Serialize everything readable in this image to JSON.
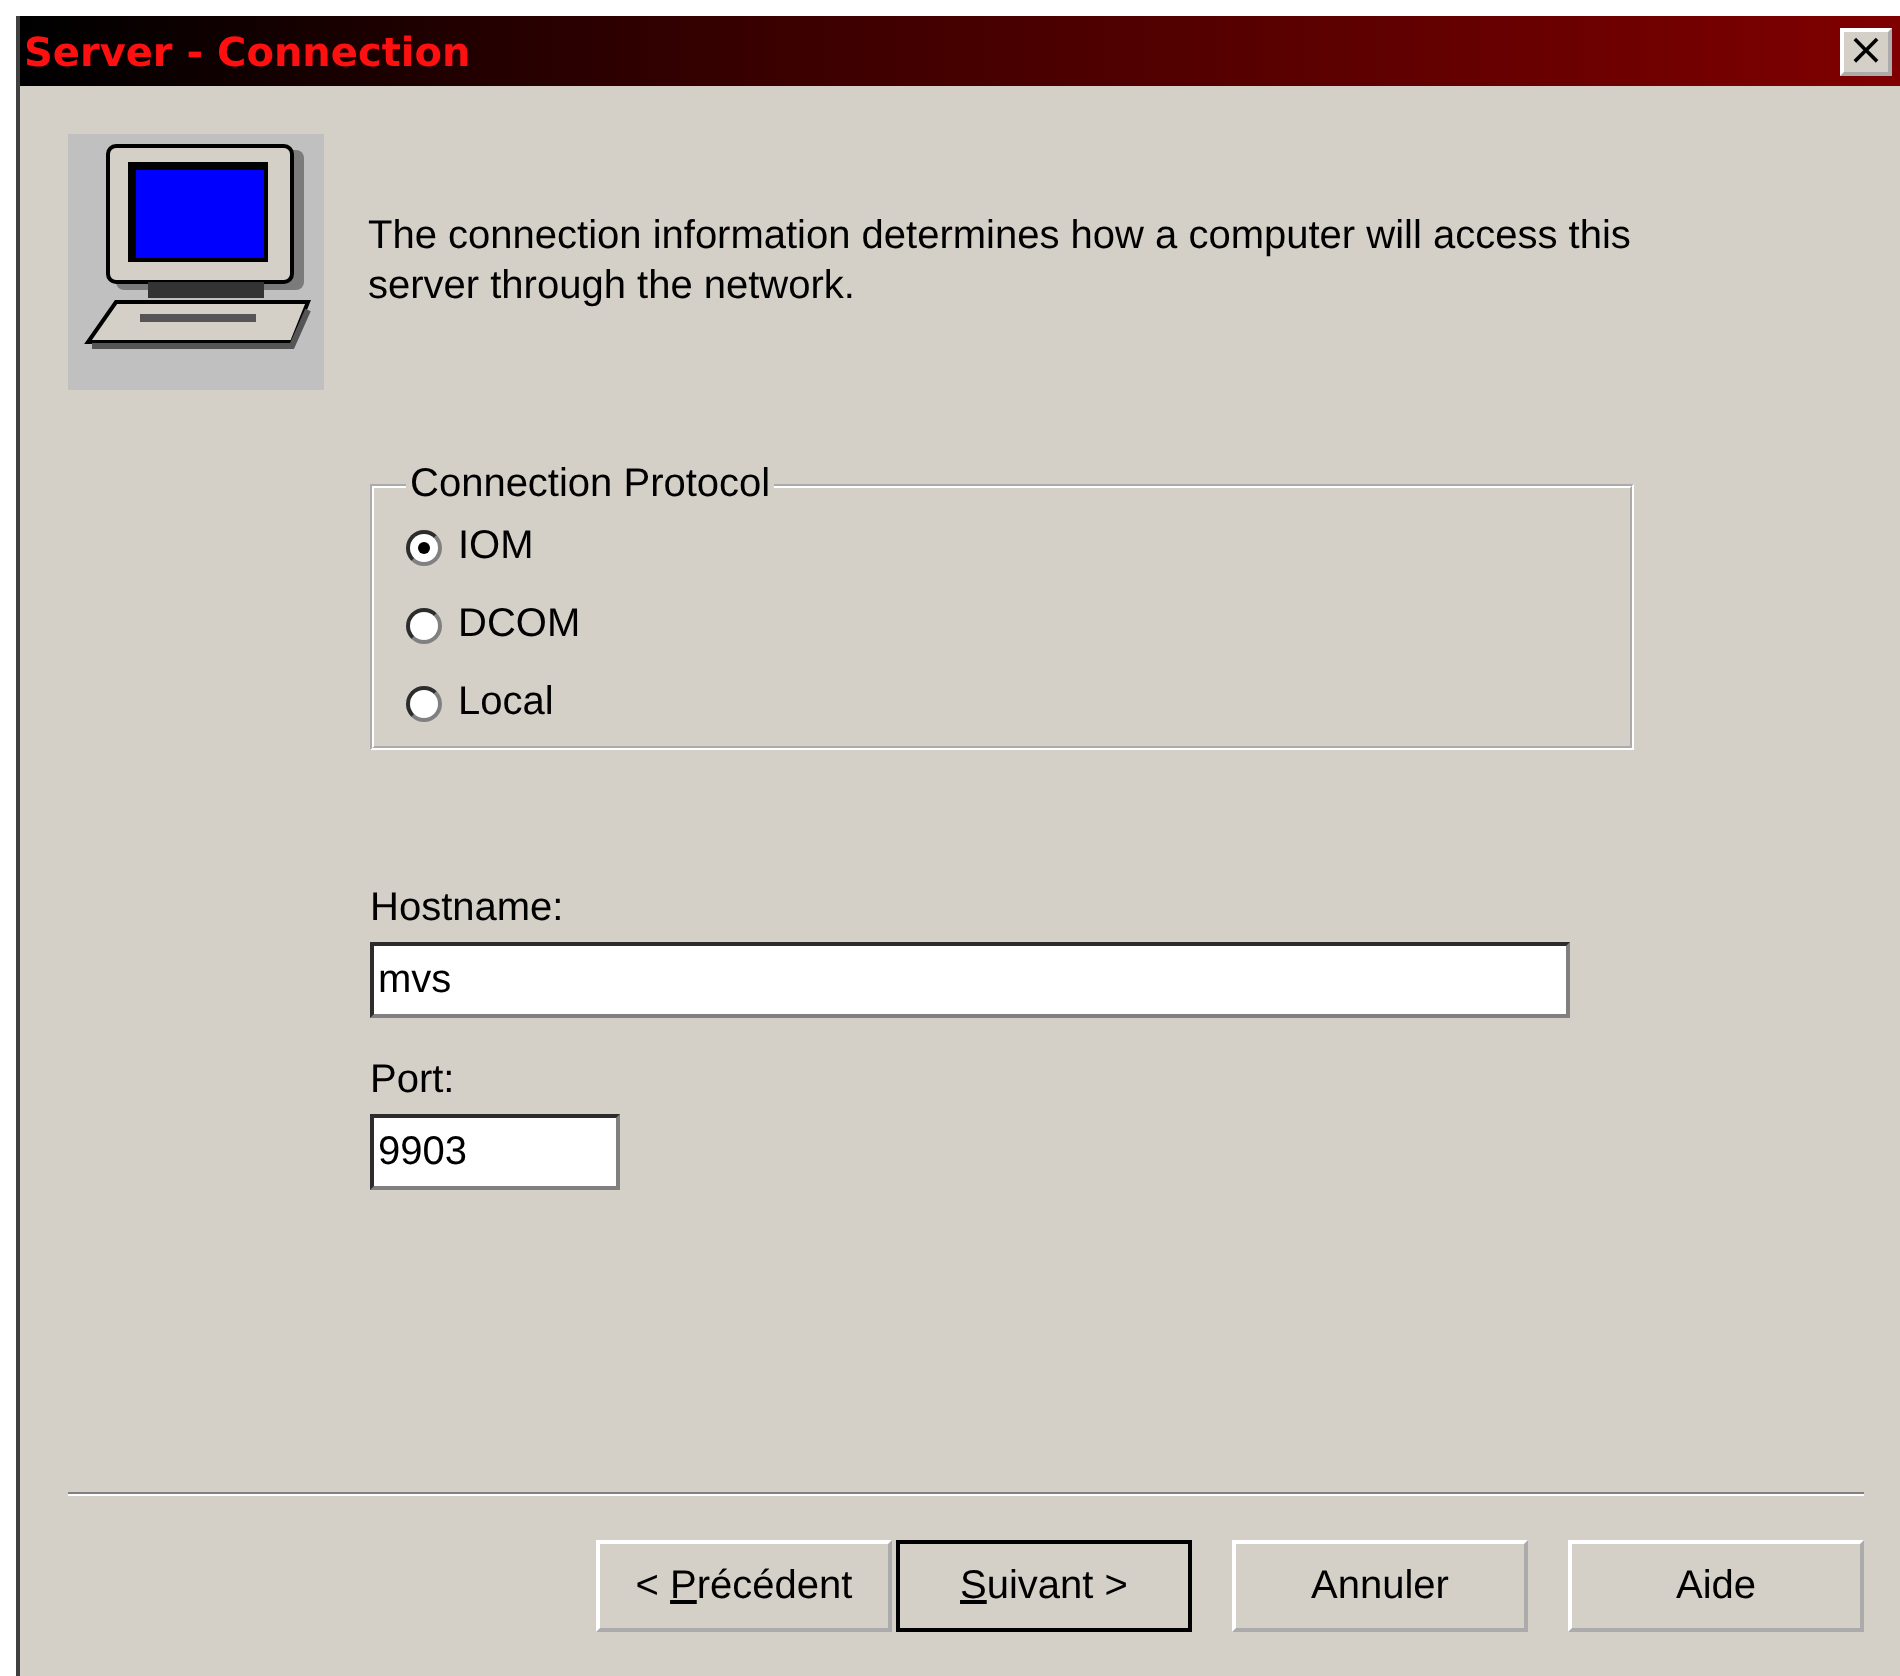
{
  "window": {
    "title": "Server - Connection",
    "close": "×"
  },
  "intro": "The connection information determines how a computer will access this server through the network.",
  "protocol_group": {
    "title": "Connection Protocol",
    "options": [
      {
        "label": "IOM",
        "selected": true
      },
      {
        "label": "DCOM",
        "selected": false
      },
      {
        "label": "Local",
        "selected": false
      }
    ]
  },
  "hostname": {
    "label": "Hostname:",
    "value": "mvs"
  },
  "port": {
    "label": "Port:",
    "value": "9903"
  },
  "buttons": [
    {
      "label": "< ",
      "mnemonic": "P",
      "label_rest": "récédent",
      "default": false
    },
    {
      "mnemonic": "S",
      "label_rest": "uivant >",
      "default": true
    },
    {
      "label": "Annuler",
      "default": false
    },
    {
      "label": "Aide",
      "default": false
    }
  ]
}
